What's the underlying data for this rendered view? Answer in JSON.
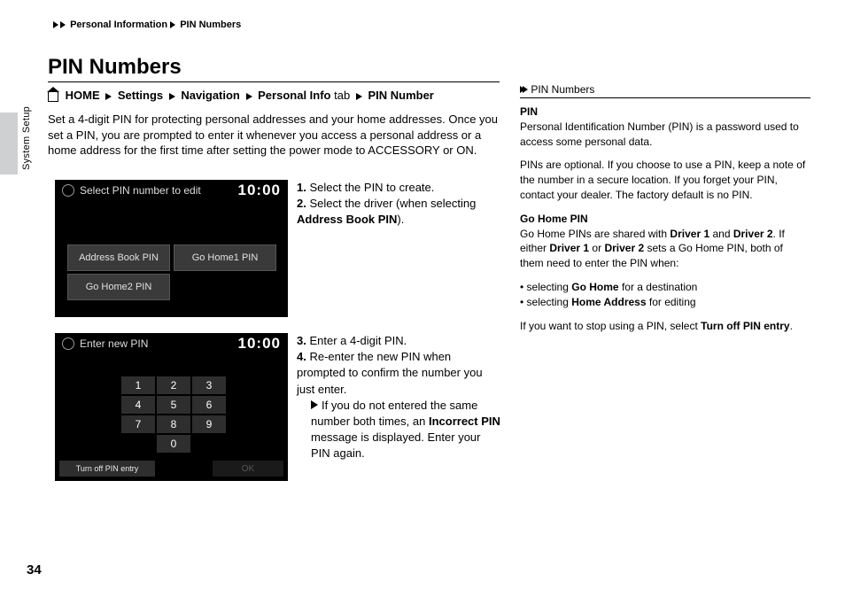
{
  "breadcrumb": {
    "level1": "Personal Information",
    "level2": "PIN Numbers"
  },
  "side_label": "System Setup",
  "title": "PIN Numbers",
  "navpath": {
    "items": [
      "HOME",
      "Settings",
      "Navigation",
      "Personal Info",
      "PIN Number"
    ],
    "tab_word": " tab"
  },
  "intro": "Set a 4-digit PIN for protecting personal addresses and your home addresses. Once you set a PIN, you are prompted to enter it whenever you access a personal address or a home address for the first time after setting the power mode to ACCESSORY or ON.",
  "screen1": {
    "title": "Select PIN number to edit",
    "clock": "10:00",
    "buttons": [
      "Address Book PIN",
      "Go Home1 PIN",
      "Go Home2 PIN"
    ]
  },
  "screen2": {
    "title": "Enter new PIN",
    "clock": "10:00",
    "keys": [
      "1",
      "2",
      "3",
      "4",
      "5",
      "6",
      "7",
      "8",
      "9",
      "0"
    ],
    "turn_off": "Turn off PIN entry",
    "ok": "OK"
  },
  "steps1": [
    {
      "n": "1.",
      "t": "Select the PIN to create."
    },
    {
      "n": "2.",
      "t": "Select the driver (when selecting",
      "bold": "Address Book PIN",
      "after": ")."
    }
  ],
  "steps2": {
    "s3": {
      "n": "3.",
      "t": "Enter a 4-digit PIN."
    },
    "s4": {
      "n": "4.",
      "t": "Re-enter the new PIN when prompted to confirm the number you just enter."
    },
    "sub": {
      "pre": "If you do not entered the same number both times, an",
      "bold": "Incorrect PIN",
      "post": "message is displayed. Enter your PIN again."
    }
  },
  "right": {
    "header": " PIN Numbers",
    "pin_heading": "PIN",
    "pin_desc": "Personal Identification Number (PIN) is a password used to access some personal data.",
    "optional": "PINs are optional. If you choose to use a PIN, keep a note of the number in a secure location. If you forget your PIN, contact your dealer. The factory default is no PIN.",
    "gohome_heading": "Go Home PIN",
    "gohome_pre": "Go Home PINs are shared with",
    "driver1": "Driver 1",
    "and": "and",
    "driver2": "Driver 2",
    "gohome_post1": ". If either",
    "driver1b": "Driver 1",
    "or": "or",
    "driver2b": "Driver 2",
    "gohome_post2": "sets a Go Home PIN, both of them need to enter the PIN when:",
    "bullet1": {
      "pre": "selecting",
      "bold": "Go Home",
      "post": "for a destination"
    },
    "bullet2": {
      "pre": "selecting",
      "bold": "Home Address",
      "post": "for editing"
    },
    "stop_pre": "If you want to stop using a PIN, select",
    "stop_bold": "Turn off PIN entry",
    "stop_post": "."
  },
  "page_number": "34"
}
